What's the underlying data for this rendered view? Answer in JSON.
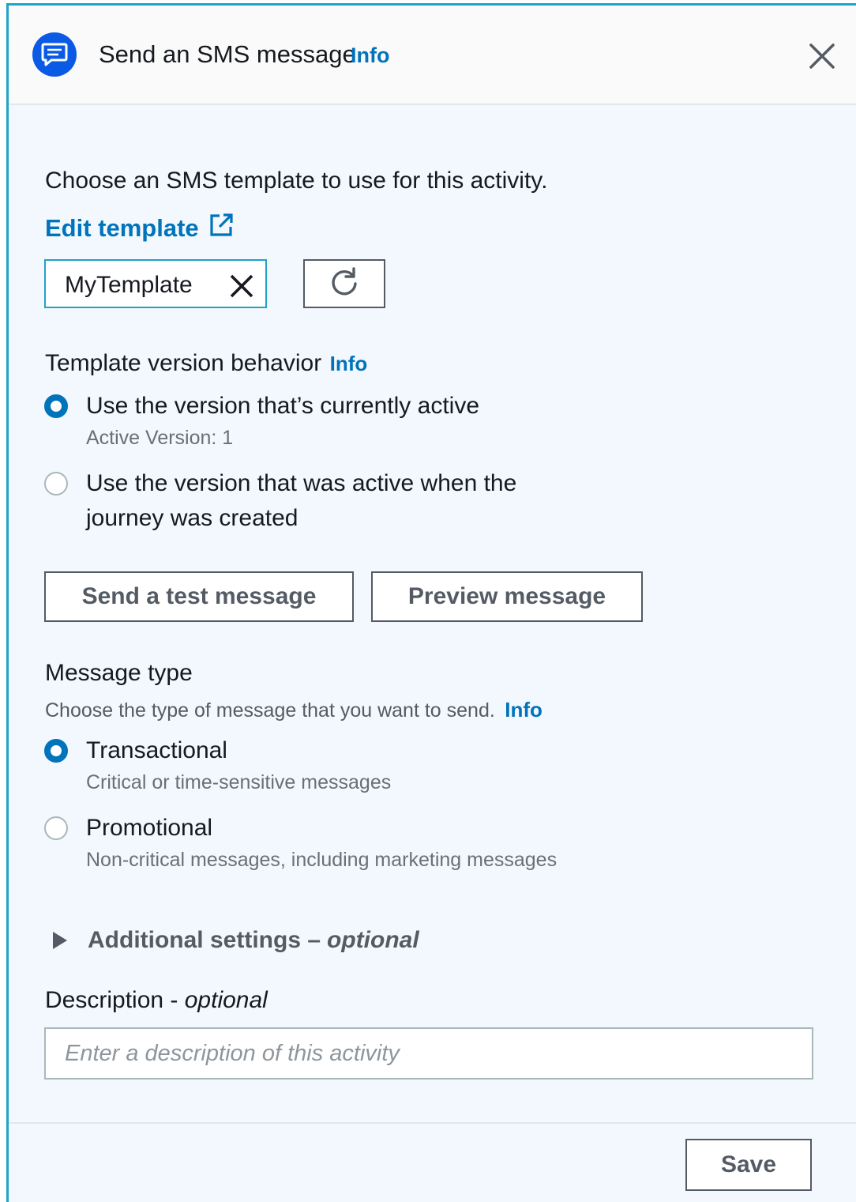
{
  "header": {
    "title": "Send an SMS message",
    "info": "Info",
    "icon": "chat-bubble-icon",
    "close_icon": "close-icon"
  },
  "template_section": {
    "intro": "Choose an SMS template to use for this activity.",
    "edit_link": "Edit template",
    "edit_icon": "external-link-icon",
    "selected_template": "MyTemplate",
    "refresh_icon": "refresh-icon"
  },
  "version_behavior": {
    "label": "Template version behavior",
    "info": "Info",
    "options": [
      {
        "label": "Use the version that’s currently active",
        "sublabel": "Active Version: 1",
        "selected": true
      },
      {
        "label_line1": "Use the version that was active when the",
        "label_line2": "journey was created",
        "selected": false
      }
    ]
  },
  "actions": {
    "send_test": "Send a test message",
    "preview": "Preview message"
  },
  "message_type": {
    "label": "Message type",
    "description": "Choose the type of message that you want to send.",
    "info": "Info",
    "options": [
      {
        "label": "Transactional",
        "sublabel": "Critical or time-sensitive messages",
        "selected": true
      },
      {
        "label": "Promotional",
        "sublabel": "Non-critical messages, including marketing messages",
        "selected": false
      }
    ]
  },
  "additional_settings": {
    "label": "Additional settings –",
    "optional": "optional"
  },
  "description_field": {
    "label": "Description -",
    "optional": "optional",
    "placeholder": "Enter a description of this activity",
    "value": ""
  },
  "footer": {
    "save": "Save"
  },
  "colors": {
    "accent": "#0073bb",
    "header_icon_bg": "#0a5ae6",
    "panel_bg": "#f2f8fd",
    "border_highlight": "#1fa3c6"
  }
}
